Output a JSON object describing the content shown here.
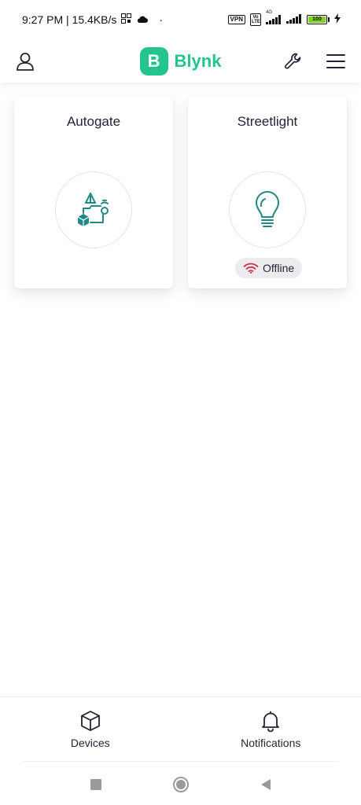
{
  "status_bar": {
    "time_speed": "9:27 PM | 15.4KB/s",
    "vpn": "VPN",
    "volte": "Vo LTE",
    "network": "4G",
    "battery": "100"
  },
  "header": {
    "logo_letter": "B",
    "logo_text": "Blynk"
  },
  "devices": [
    {
      "title": "Autogate",
      "icon": "automation-icon"
    },
    {
      "title": "Streetlight",
      "icon": "lightbulb-icon",
      "status": "Offline"
    }
  ],
  "bottom_nav": {
    "devices_label": "Devices",
    "notifications_label": "Notifications"
  },
  "colors": {
    "brand": "#23c48e",
    "icon_teal": "#1f8a86",
    "offline_red": "#d0304f"
  }
}
